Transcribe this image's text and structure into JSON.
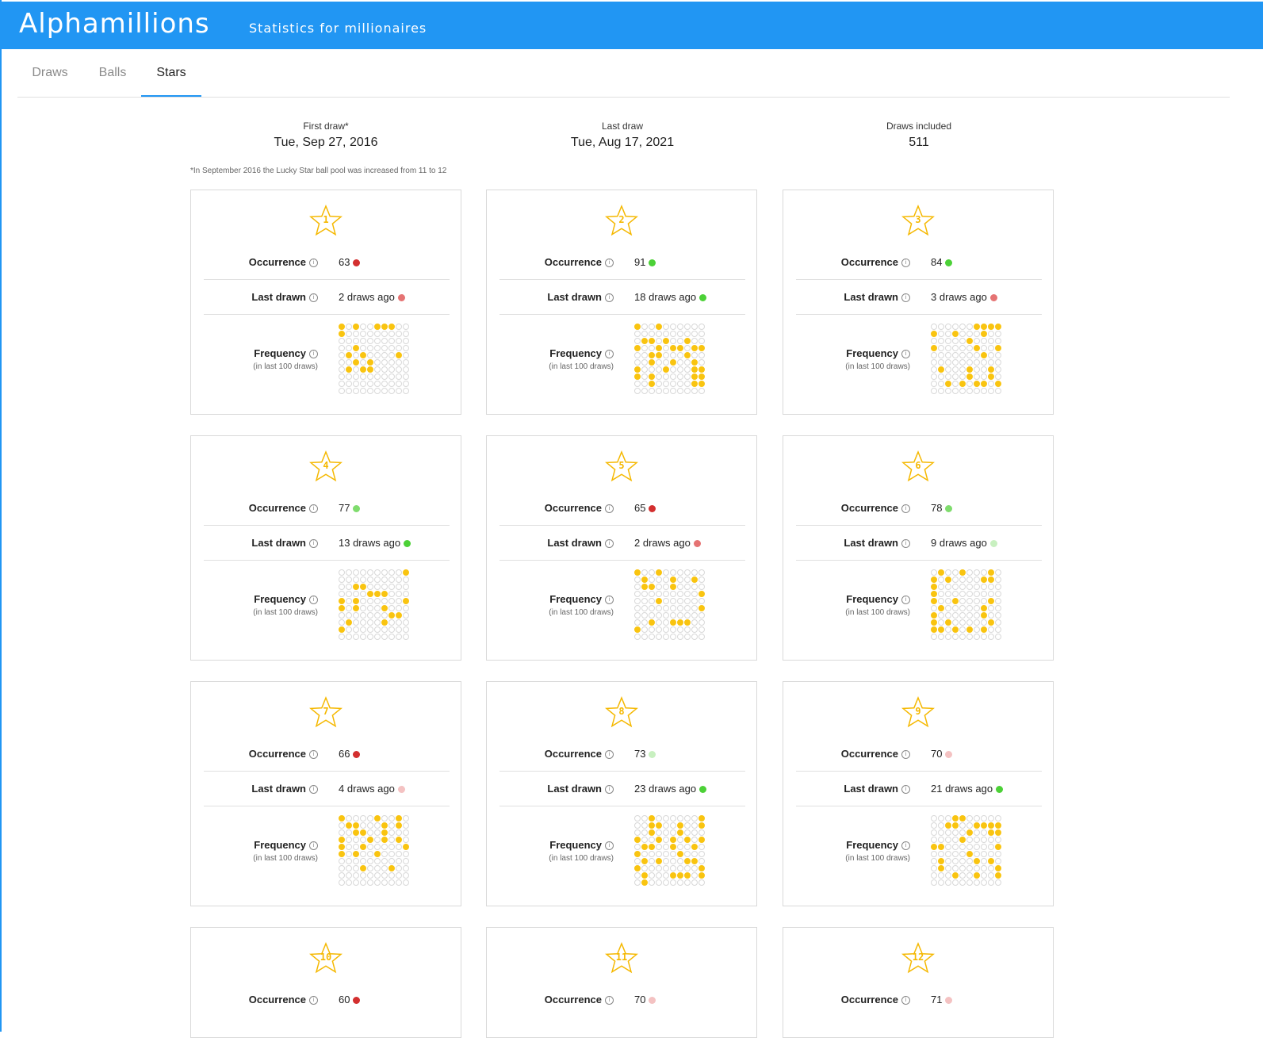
{
  "header": {
    "logo": "Alphamillions",
    "tagline": "Statistics for millionaires"
  },
  "tabs": [
    {
      "label": "Draws",
      "active": false
    },
    {
      "label": "Balls",
      "active": false
    },
    {
      "label": "Stars",
      "active": true
    }
  ],
  "summary": {
    "first_draw_label": "First draw*",
    "first_draw_value": "Tue, Sep 27, 2016",
    "last_draw_label": "Last draw",
    "last_draw_value": "Tue, Aug 17, 2021",
    "draws_included_label": "Draws included",
    "draws_included_value": "511",
    "footnote": "*In September 2016 the Lucky Star ball pool was increased from 11 to 12"
  },
  "labels": {
    "occurrence": "Occurrence",
    "last_drawn": "Last drawn",
    "frequency": "Frequency",
    "frequency_sub": "(in last 100 draws)",
    "info_icon": "i"
  },
  "colors": {
    "accent": "#2196f3",
    "star": "#f5b800",
    "ball": "#f9c410",
    "dark_red": "#d32f2f",
    "light_red": "#e57373",
    "pale_red": "#f4c2c2",
    "green": "#4cd137",
    "light_green": "#7fdc6d",
    "pale_green": "#c8f0c0"
  },
  "stars": [
    {
      "number": "1",
      "occurrence": "63",
      "occ_color": "#d32f2f",
      "last_drawn": "2 draws ago",
      "ld_color": "#e57373",
      "frequency": [
        1,
        3,
        6,
        7,
        8,
        11,
        33,
        42,
        44,
        49,
        53,
        55,
        62,
        64,
        65
      ]
    },
    {
      "number": "2",
      "occurrence": "91",
      "occ_color": "#4cd137",
      "last_drawn": "18 draws ago",
      "ld_color": "#4cd137",
      "frequency": [
        1,
        4,
        22,
        23,
        25,
        28,
        31,
        34,
        36,
        37,
        39,
        40,
        43,
        44,
        48,
        53,
        56,
        59,
        61,
        65,
        69,
        70,
        71,
        73,
        79,
        80,
        83,
        89,
        90
      ]
    },
    {
      "number": "3",
      "occurrence": "84",
      "occ_color": "#4cd137",
      "last_drawn": "3 draws ago",
      "ld_color": "#e57373",
      "frequency": [
        7,
        8,
        9,
        10,
        11,
        14,
        18,
        26,
        31,
        37,
        40,
        48,
        62,
        66,
        69,
        76,
        79,
        83,
        85,
        87,
        88,
        90
      ]
    },
    {
      "number": "4",
      "occurrence": "77",
      "occ_color": "#7fdc6d",
      "last_drawn": "13 draws ago",
      "ld_color": "#4cd137",
      "frequency": [
        10,
        23,
        24,
        35,
        36,
        37,
        41,
        43,
        50,
        51,
        53,
        57,
        68,
        69,
        72,
        77,
        81
      ]
    },
    {
      "number": "5",
      "occurrence": "65",
      "occ_color": "#d32f2f",
      "last_drawn": "2 draws ago",
      "ld_color": "#e57373",
      "frequency": [
        1,
        4,
        12,
        16,
        19,
        22,
        23,
        26,
        40,
        44,
        60,
        73,
        76,
        77,
        78,
        81
      ]
    },
    {
      "number": "6",
      "occurrence": "78",
      "occ_color": "#7fdc6d",
      "last_drawn": "9 draws ago",
      "ld_color": "#c8f0c0",
      "frequency": [
        2,
        5,
        9,
        11,
        13,
        18,
        19,
        21,
        31,
        41,
        44,
        49,
        52,
        58,
        61,
        68,
        71,
        73,
        79,
        81,
        82,
        84,
        86,
        88
      ]
    },
    {
      "number": "7",
      "occurrence": "66",
      "occ_color": "#d32f2f",
      "last_drawn": "4 draws ago",
      "ld_color": "#f4c2c2",
      "frequency": [
        1,
        6,
        9,
        12,
        13,
        17,
        19,
        23,
        24,
        27,
        31,
        35,
        37,
        39,
        41,
        44,
        50,
        51,
        53,
        56,
        78,
        74
      ]
    },
    {
      "number": "8",
      "occurrence": "73",
      "occ_color": "#c8f0c0",
      "last_drawn": "23 draws ago",
      "ld_color": "#4cd137",
      "frequency": [
        3,
        10,
        13,
        14,
        17,
        20,
        23,
        27,
        31,
        34,
        36,
        38,
        40,
        42,
        43,
        46,
        49,
        51,
        57,
        62,
        64,
        68,
        69,
        71,
        80,
        82,
        86,
        87,
        88,
        90,
        92
      ]
    },
    {
      "number": "9",
      "occurrence": "70",
      "occ_color": "#f4c2c2",
      "last_drawn": "21 draws ago",
      "ld_color": "#4cd137",
      "frequency": [
        4,
        5,
        13,
        14,
        17,
        18,
        19,
        20,
        26,
        29,
        30,
        35,
        41,
        42,
        50,
        56,
        62,
        67,
        69,
        72,
        80,
        84,
        87,
        90
      ]
    },
    {
      "number": "10",
      "occurrence": "60",
      "occ_color": "#d32f2f"
    },
    {
      "number": "11",
      "occurrence": "70",
      "occ_color": "#f4c2c2"
    },
    {
      "number": "12",
      "occurrence": "71",
      "occ_color": "#f4c2c2"
    }
  ]
}
